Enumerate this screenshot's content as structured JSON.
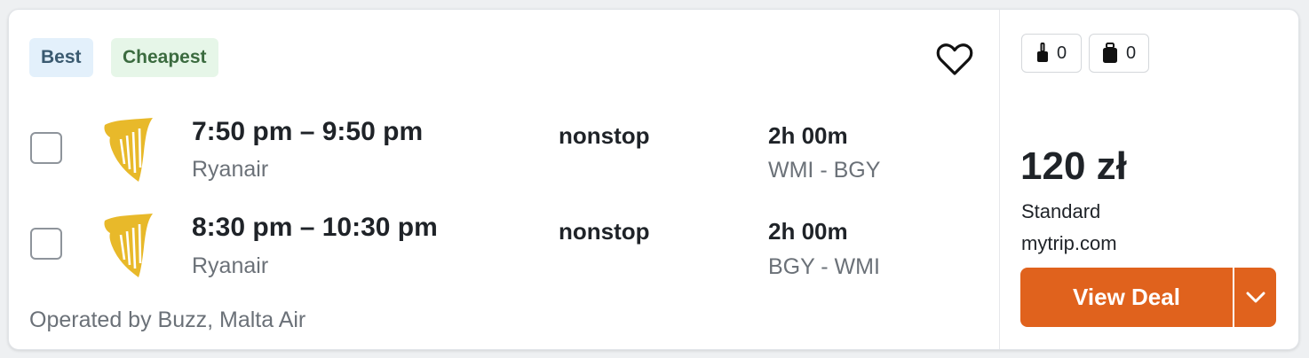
{
  "tags": {
    "best": "Best",
    "cheapest": "Cheapest"
  },
  "icons": {
    "save": "heart-icon",
    "carry_on": "carry-on-bag-icon",
    "checked": "checked-bag-icon",
    "airline_logo": "ryanair-harp-logo",
    "expand": "chevron-down-icon"
  },
  "flights": [
    {
      "times": "7:50 pm – 9:50 pm",
      "airline": "Ryanair",
      "stops": "nonstop",
      "duration": "2h 00m",
      "route": "WMI - BGY"
    },
    {
      "times": "8:30 pm – 10:30 pm",
      "airline": "Ryanair",
      "stops": "nonstop",
      "duration": "2h 00m",
      "route": "BGY - WMI"
    }
  ],
  "operated_by": "Operated by Buzz, Malta Air",
  "bags": {
    "carry_on_count": "0",
    "checked_count": "0"
  },
  "price": {
    "amount": "120 zł",
    "fare_type": "Standard",
    "provider": "mytrip.com"
  },
  "cta": {
    "label": "View Deal"
  },
  "colors": {
    "cta": "#e0621d",
    "logo_gold": "#e8b92a",
    "best_bg": "#e3f0fb",
    "cheapest_bg": "#e6f6e8"
  }
}
